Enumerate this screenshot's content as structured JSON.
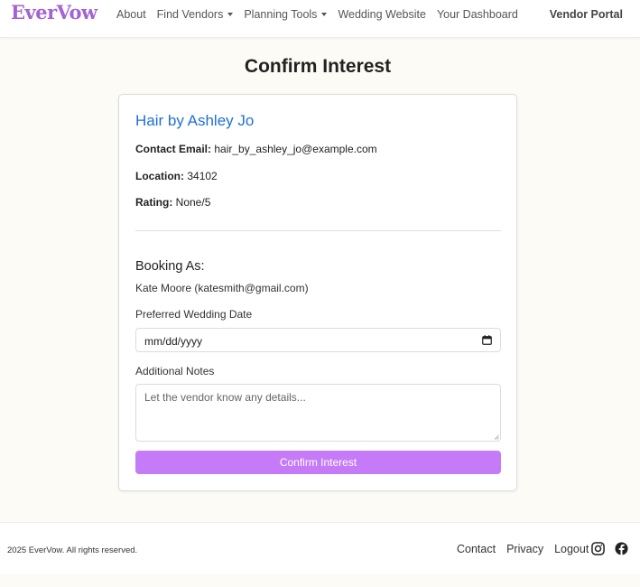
{
  "nav": {
    "brand": "EverVow",
    "links": [
      {
        "label": "About",
        "dropdown": false
      },
      {
        "label": "Find Vendors",
        "dropdown": true
      },
      {
        "label": "Planning Tools",
        "dropdown": true
      },
      {
        "label": "Wedding Website",
        "dropdown": false
      },
      {
        "label": "Your Dashboard",
        "dropdown": false
      }
    ],
    "vendor_portal": "Vendor Portal"
  },
  "page": {
    "title": "Confirm Interest"
  },
  "vendor": {
    "name": "Hair by Ashley Jo",
    "email_label": "Contact Email:",
    "email": "hair_by_ashley_jo@example.com",
    "location_label": "Location:",
    "location": "34102",
    "rating_label": "Rating:",
    "rating": "None/5"
  },
  "booking": {
    "heading": "Booking As:",
    "user": "Kate Moore (katesmith@gmail.com)"
  },
  "form": {
    "date_label": "Preferred Wedding Date",
    "date_value": "mm/dd/yyyy",
    "notes_label": "Additional Notes",
    "notes_placeholder": "Let the vendor know any details...",
    "submit_label": "Confirm Interest"
  },
  "footer": {
    "copyright": "2025 EverVow. All rights reserved.",
    "links": [
      "Contact",
      "Privacy",
      "Logout"
    ],
    "social": [
      "instagram-icon",
      "facebook-icon"
    ]
  },
  "colors": {
    "brand": "#a463d4",
    "vendor_name": "#1f6fd8",
    "button": "#c57bf8",
    "background": "#fdfbf5"
  }
}
